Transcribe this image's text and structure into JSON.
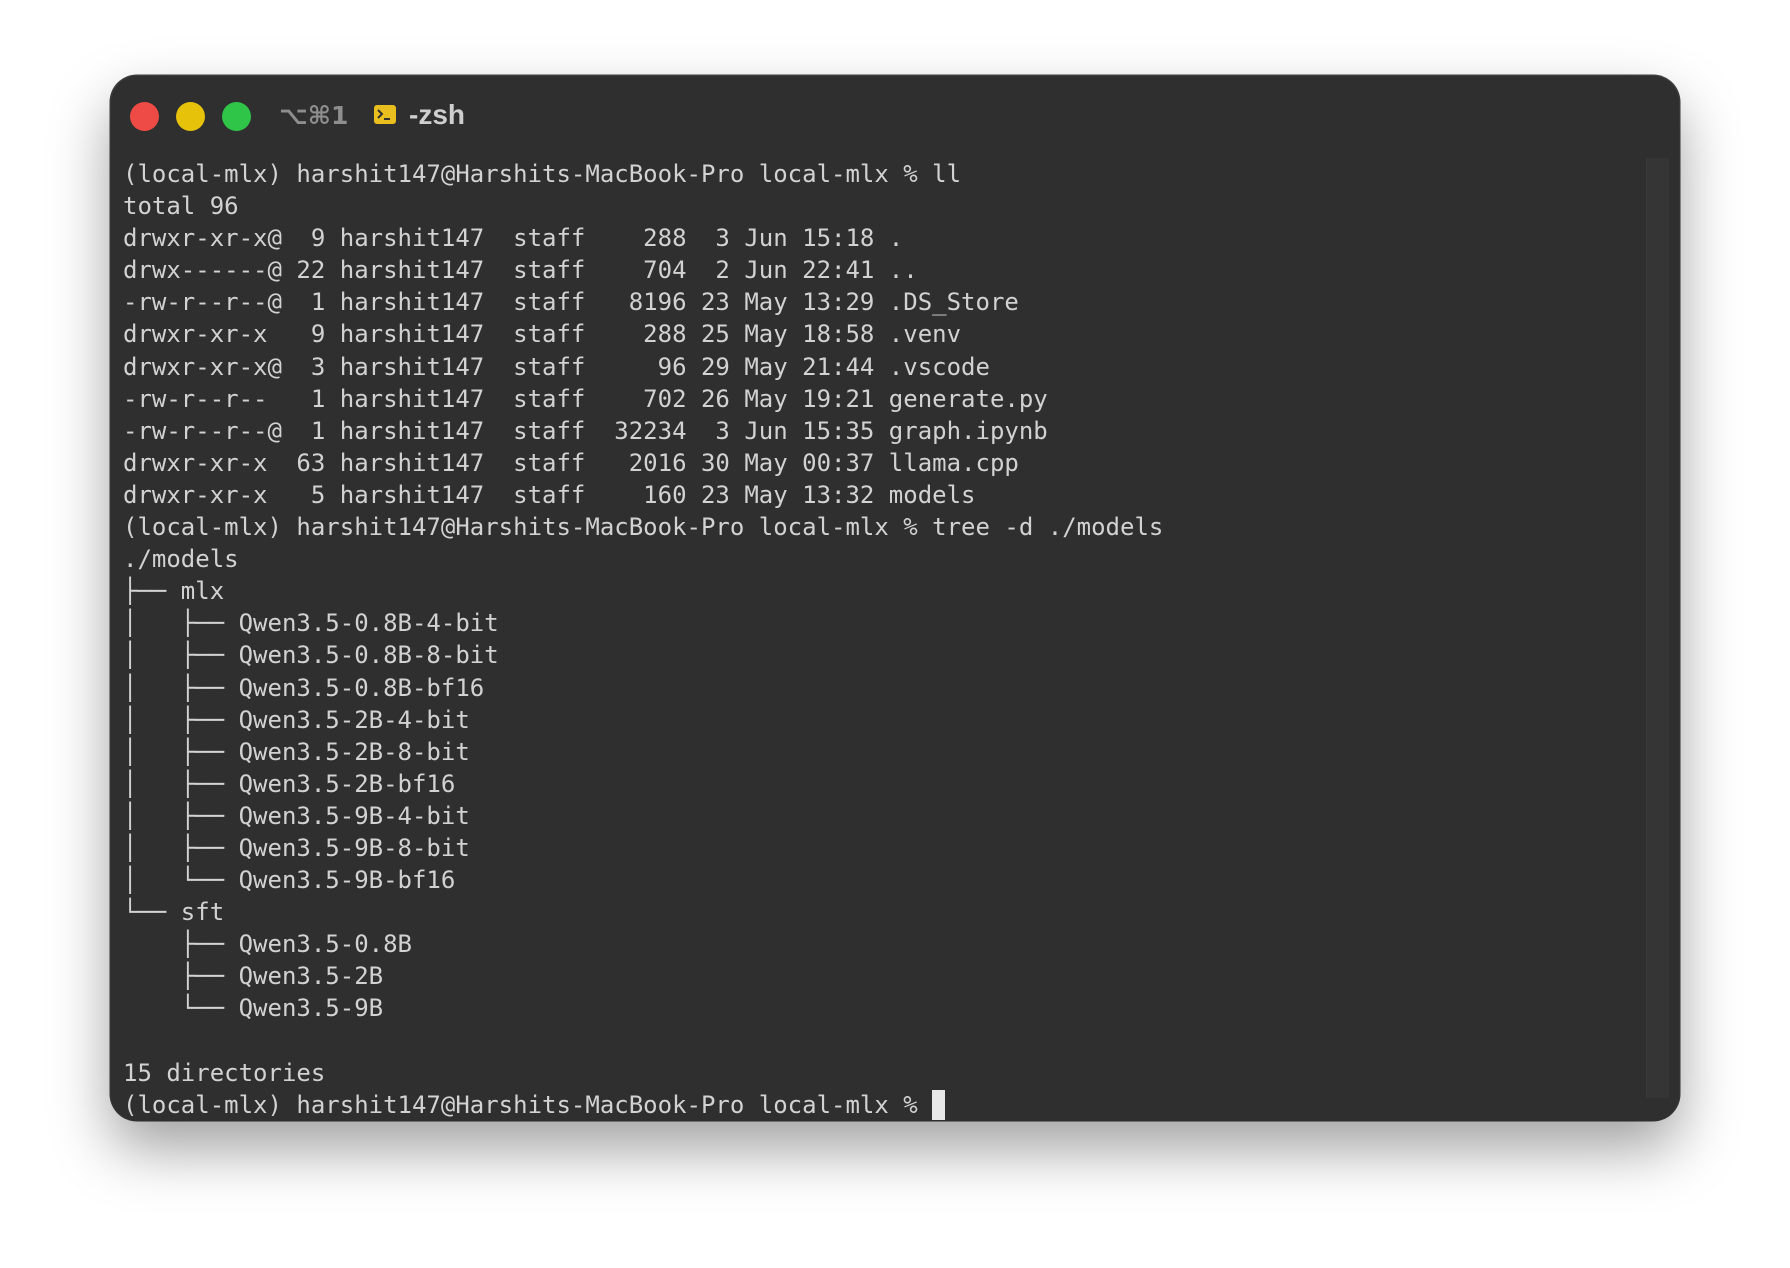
{
  "window": {
    "shortcut": "⌥⌘1",
    "tab_title": "-zsh",
    "colors": {
      "background": "#2f2f2f",
      "text": "#d2d2d2",
      "close": "#ee4b47",
      "minimize": "#e6c20a",
      "maximize": "#2ec548",
      "terminal_icon": "#e9bf1f"
    },
    "icons": [
      "close-icon",
      "minimize-icon",
      "maximize-icon",
      "terminal-icon"
    ]
  },
  "terminal": {
    "lines": [
      "(local-mlx) harshit147@Harshits-MacBook-Pro local-mlx % ll",
      "total 96",
      "drwxr-xr-x@  9 harshit147  staff    288  3 Jun 15:18 .",
      "drwx------@ 22 harshit147  staff    704  2 Jun 22:41 ..",
      "-rw-r--r--@  1 harshit147  staff   8196 23 May 13:29 .DS_Store",
      "drwxr-xr-x   9 harshit147  staff    288 25 May 18:58 .venv",
      "drwxr-xr-x@  3 harshit147  staff     96 29 May 21:44 .vscode",
      "-rw-r--r--   1 harshit147  staff    702 26 May 19:21 generate.py",
      "-rw-r--r--@  1 harshit147  staff  32234  3 Jun 15:35 graph.ipynb",
      "drwxr-xr-x  63 harshit147  staff   2016 30 May 00:37 llama.cpp",
      "drwxr-xr-x   5 harshit147  staff    160 23 May 13:32 models",
      "(local-mlx) harshit147@Harshits-MacBook-Pro local-mlx % tree -d ./models",
      "./models",
      "├── mlx",
      "│   ├── Qwen3.5-0.8B-4-bit",
      "│   ├── Qwen3.5-0.8B-8-bit",
      "│   ├── Qwen3.5-0.8B-bf16",
      "│   ├── Qwen3.5-2B-4-bit",
      "│   ├── Qwen3.5-2B-8-bit",
      "│   ├── Qwen3.5-2B-bf16",
      "│   ├── Qwen3.5-9B-4-bit",
      "│   ├── Qwen3.5-9B-8-bit",
      "│   └── Qwen3.5-9B-bf16",
      "└── sft",
      "    ├── Qwen3.5-0.8B",
      "    ├── Qwen3.5-2B",
      "    └── Qwen3.5-9B",
      "",
      "15 directories"
    ],
    "prompt": "(local-mlx) harshit147@Harshits-MacBook-Pro local-mlx %"
  }
}
